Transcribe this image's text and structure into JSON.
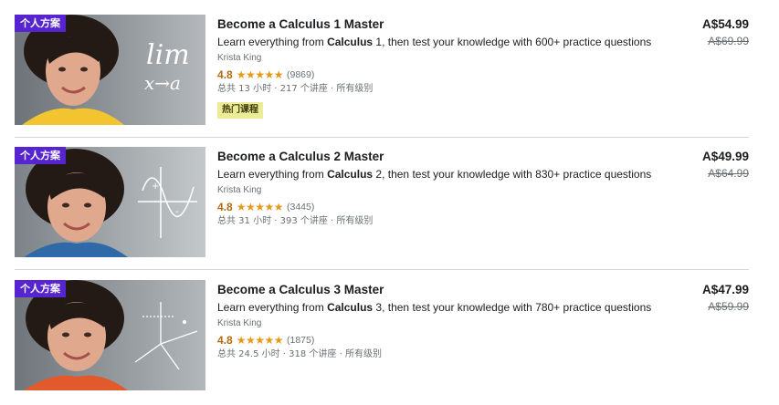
{
  "courses": [
    {
      "badge": "个人方案",
      "title": "Become a Calculus 1 Master",
      "headline_pre": "Learn everything from ",
      "headline_bold": "Calculus",
      "headline_post": " 1, then test your knowledge with 600+ practice questions",
      "instructor": "Krista King",
      "rating": "4.8",
      "stars": "★★★★★",
      "rating_count": "(9869)",
      "meta": "总共 13 小时 · 217 个讲座 · 所有级别",
      "tag": "热门课程",
      "price_current": "A$54.99",
      "price_original": "A$69.99",
      "thumb_overlay": [
        "lim",
        "x→a"
      ]
    },
    {
      "badge": "个人方案",
      "title": "Become a Calculus 2 Master",
      "headline_pre": "Learn everything from ",
      "headline_bold": "Calculus",
      "headline_post": " 2, then test your knowledge with 830+ practice questions",
      "instructor": "Krista King",
      "rating": "4.8",
      "stars": "★★★★★",
      "rating_count": "(3445)",
      "meta": "总共 31 小时 · 393 个讲座 · 所有级别",
      "price_current": "A$49.99",
      "price_original": "A$64.99"
    },
    {
      "badge": "个人方案",
      "title": "Become a Calculus 3 Master",
      "headline_pre": "Learn everything from ",
      "headline_bold": "Calculus",
      "headline_post": " 3, then test your knowledge with 780+ practice questions",
      "instructor": "Krista King",
      "rating": "4.8",
      "stars": "★★★★★",
      "rating_count": "(1875)",
      "meta": "总共 24.5 小时 · 318 个讲座 · 所有级别",
      "price_current": "A$47.99",
      "price_original": "A$59.99"
    }
  ],
  "colors": {
    "badge": "#5624d0",
    "rating": "#b4690e",
    "stars": "#e59819",
    "tag_bg": "#eceb98"
  }
}
